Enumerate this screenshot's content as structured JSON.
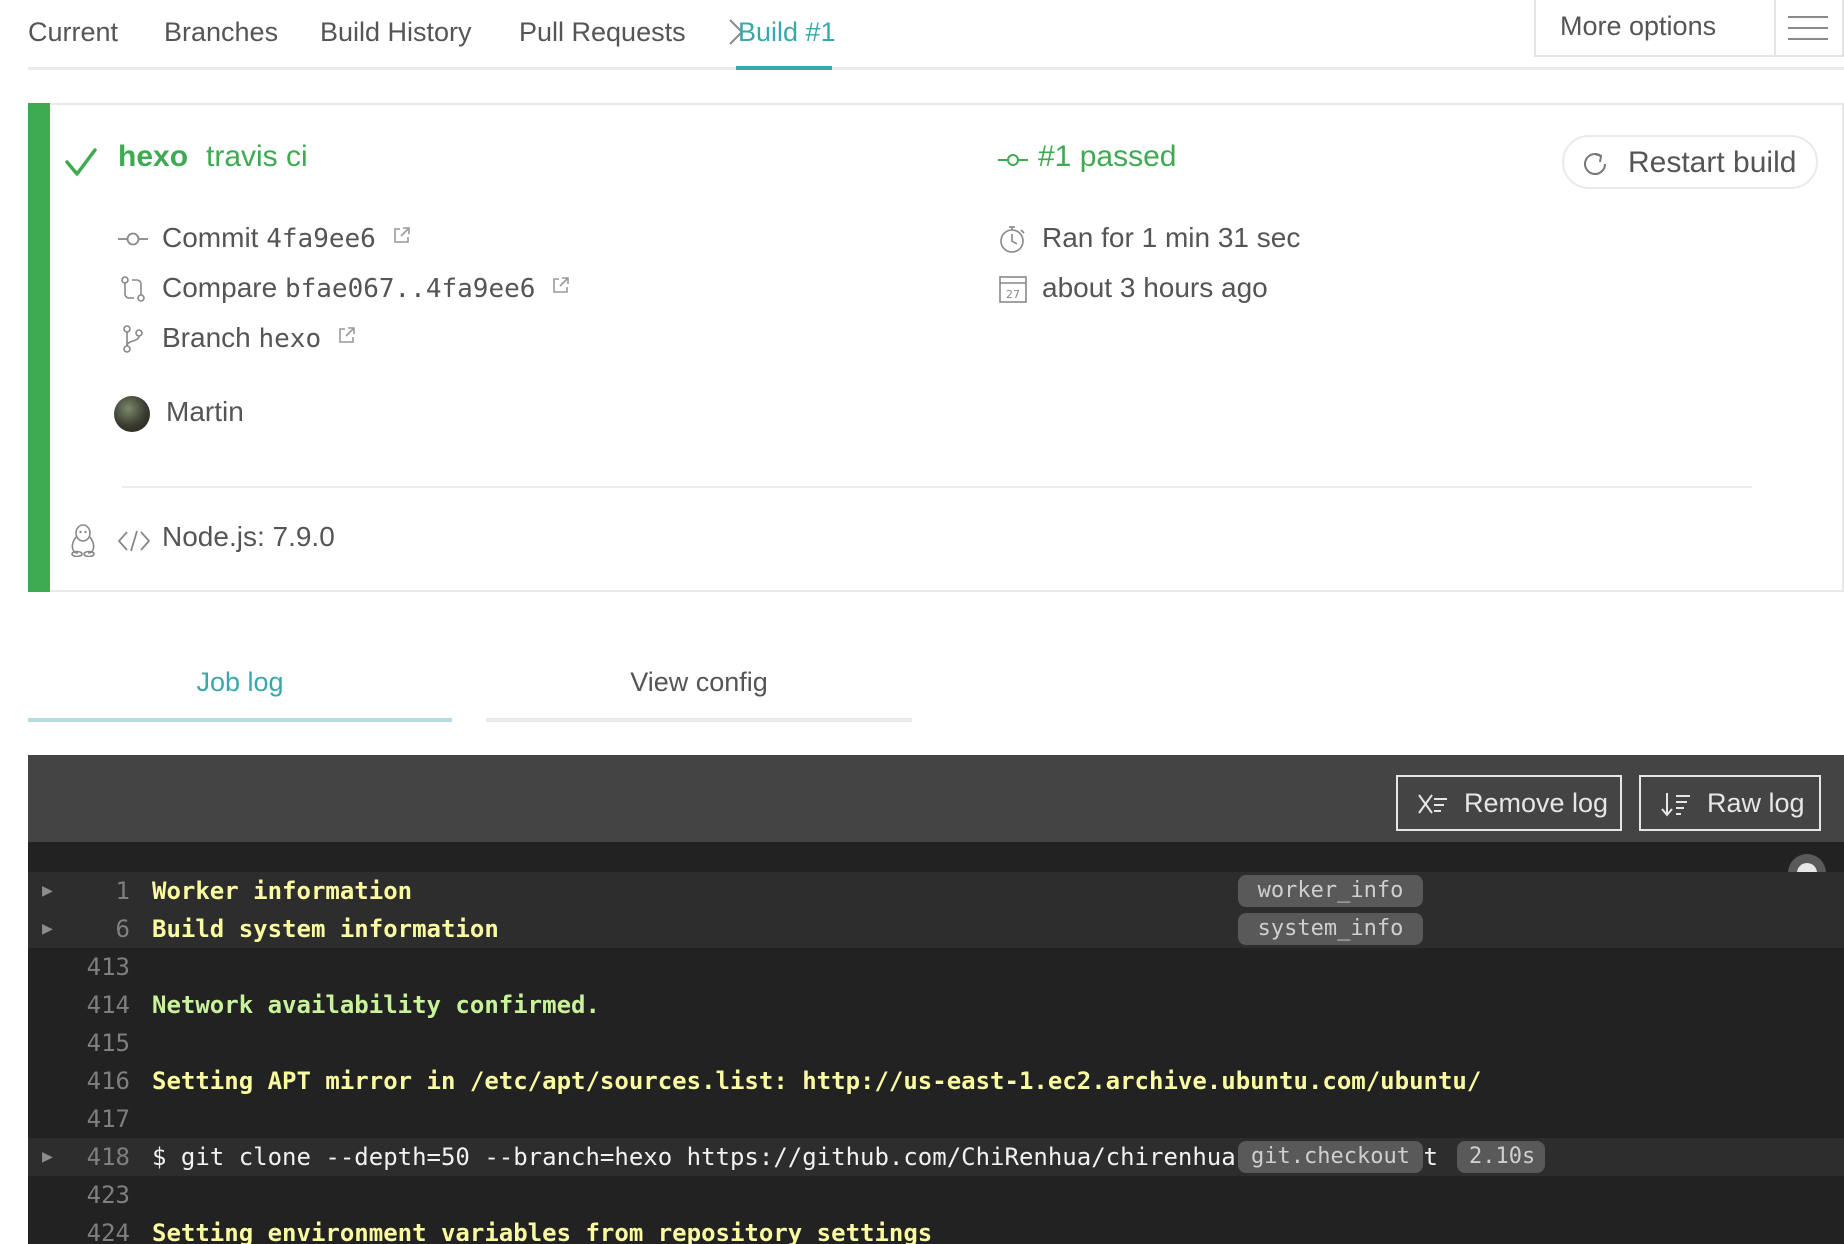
{
  "nav": {
    "items": [
      {
        "label": "Current"
      },
      {
        "label": "Branches"
      },
      {
        "label": "Build History"
      },
      {
        "label": "Pull Requests"
      },
      {
        "label": "Build #1"
      }
    ],
    "active_index": 4,
    "more_options": "More options"
  },
  "build": {
    "repo": "hexo",
    "message": "travis ci",
    "status": "#1 passed",
    "status_color": "#3eaa52",
    "restart_label": "Restart build",
    "commit_label": "Commit",
    "commit_sha": "4fa9ee6",
    "compare_label": "Compare",
    "compare_range": "bfae067..4fa9ee6",
    "branch_label": "Branch",
    "branch_name": "hexo",
    "duration": "Ran for 1 min 31 sec",
    "finished": "about 3 hours ago",
    "author": "Martin",
    "language": "Node.js: 7.9.0",
    "calendar_day": "27"
  },
  "tabs": {
    "job_log": "Job log",
    "view_config": "View config"
  },
  "log": {
    "remove_label": "Remove log",
    "raw_label": "Raw log",
    "lines": [
      {
        "num": "1",
        "text": "Worker information",
        "style": "yellow",
        "fold": true,
        "tag": "worker_info",
        "time": ""
      },
      {
        "num": "6",
        "text": "Build system information",
        "style": "yellow",
        "fold": true,
        "tag": "system_info",
        "time": ""
      },
      {
        "num": "413",
        "text": "",
        "style": "white",
        "fold": false,
        "tag": "",
        "time": ""
      },
      {
        "num": "414",
        "text": "Network availability confirmed.",
        "style": "green",
        "fold": false,
        "tag": "",
        "time": ""
      },
      {
        "num": "415",
        "text": "",
        "style": "white",
        "fold": false,
        "tag": "",
        "time": ""
      },
      {
        "num": "416",
        "text": "Setting APT mirror in /etc/apt/sources.list: http://us-east-1.ec2.archive.ubuntu.com/ubuntu/",
        "style": "yellow",
        "fold": false,
        "tag": "",
        "time": ""
      },
      {
        "num": "417",
        "text": "",
        "style": "white",
        "fold": false,
        "tag": "",
        "time": ""
      },
      {
        "num": "418",
        "text": "$ git clone --depth=50 --branch=hexo https://github.com/ChiRenhua/chirenhua.github.io.git",
        "style": "white",
        "fold": true,
        "tag": "git.checkout",
        "time": "2.10s"
      },
      {
        "num": "423",
        "text": "",
        "style": "white",
        "fold": false,
        "tag": "",
        "time": ""
      },
      {
        "num": "424",
        "text": "Setting environment variables from repository settings",
        "style": "yellow",
        "fold": false,
        "tag": "",
        "time": ""
      }
    ]
  }
}
